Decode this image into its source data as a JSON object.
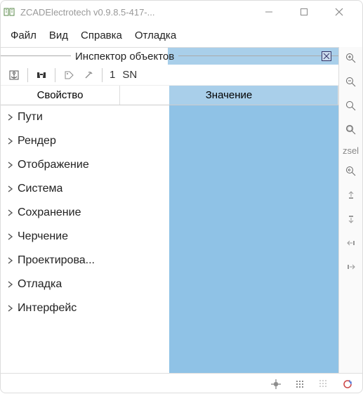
{
  "window": {
    "title": "ZCADElectrotech v0.9.8.5-417-..."
  },
  "menubar": {
    "items": [
      "Файл",
      "Вид",
      "Справка",
      "Отладка"
    ]
  },
  "inspector": {
    "title": "Инспектор объектов",
    "toolbar": {
      "number": "1",
      "sn": "SN"
    },
    "columns": {
      "prop": "Свойство",
      "val": "Значение"
    },
    "tree": [
      "Пути",
      "Рендер",
      "Отображение",
      "Система",
      "Сохранение",
      "Черчение",
      "Проектирова...",
      "Отладка",
      "Интерфейс"
    ]
  },
  "rightbar": {
    "zsel": "zsel"
  }
}
